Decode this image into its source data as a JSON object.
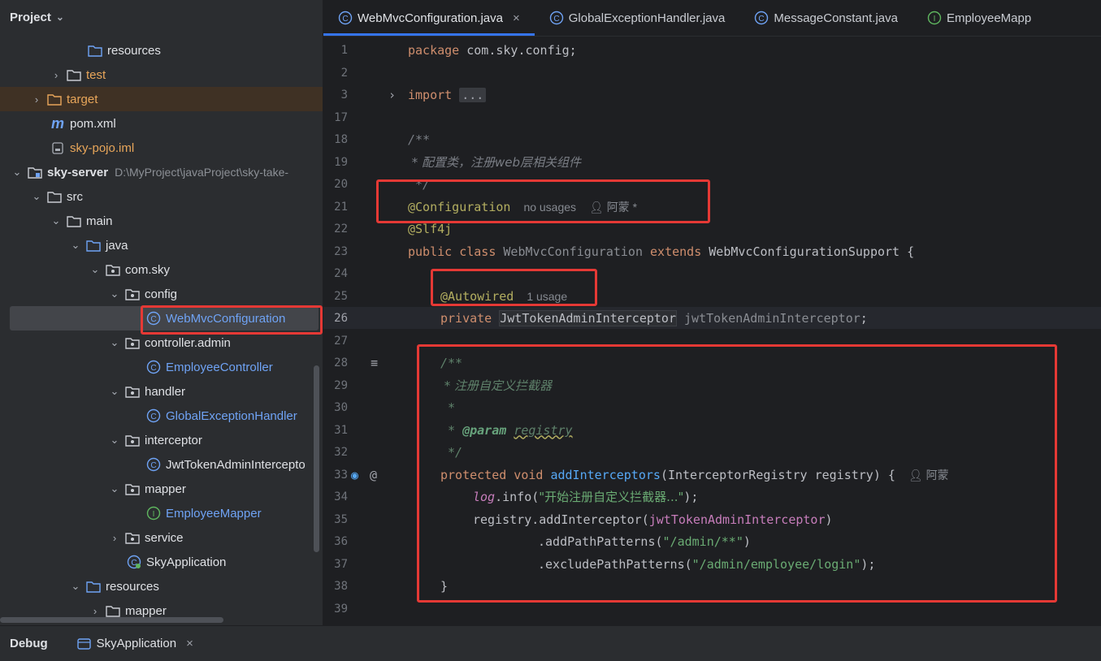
{
  "project_panel": {
    "title": "Project",
    "tree": [
      {
        "label": "resources",
        "icon": "folder-icon",
        "style": "normal"
      },
      {
        "label": "test",
        "icon": "folder-icon",
        "style": "orange",
        "expanded": false
      },
      {
        "label": "target",
        "icon": "folder-orange-icon",
        "style": "orange",
        "expanded": false
      },
      {
        "label": "pom.xml",
        "icon": "maven-icon",
        "style": "normal"
      },
      {
        "label": "sky-pojo.iml",
        "icon": "iml-file-icon",
        "style": "orange"
      },
      {
        "label": "sky-server",
        "path": "D:\\MyProject\\javaProject\\sky-take-",
        "icon": "module-folder-icon",
        "style": "bold",
        "expanded": true
      },
      {
        "label": "src",
        "icon": "folder-icon",
        "style": "normal",
        "expanded": true
      },
      {
        "label": "main",
        "icon": "folder-icon",
        "style": "normal",
        "expanded": true
      },
      {
        "label": "java",
        "icon": "source-folder-icon",
        "style": "normal",
        "expanded": true
      },
      {
        "label": "com.sky",
        "icon": "package-icon",
        "style": "normal",
        "expanded": true
      },
      {
        "label": "config",
        "icon": "package-icon",
        "style": "normal",
        "expanded": true
      },
      {
        "label": "WebMvcConfiguration",
        "icon": "class-icon",
        "style": "blue",
        "selected": true
      },
      {
        "label": "controller.admin",
        "icon": "package-icon",
        "style": "normal",
        "expanded": true
      },
      {
        "label": "EmployeeController",
        "icon": "class-icon",
        "style": "blue"
      },
      {
        "label": "handler",
        "icon": "package-icon",
        "style": "normal",
        "expanded": true
      },
      {
        "label": "GlobalExceptionHandler",
        "icon": "class-icon",
        "style": "blue"
      },
      {
        "label": "interceptor",
        "icon": "package-icon",
        "style": "normal",
        "expanded": true
      },
      {
        "label": "JwtTokenAdminIntercepto",
        "icon": "class-icon",
        "style": "normal"
      },
      {
        "label": "mapper",
        "icon": "package-icon",
        "style": "normal",
        "expanded": true
      },
      {
        "label": "EmployeeMapper",
        "icon": "interface-icon",
        "style": "blue"
      },
      {
        "label": "service",
        "icon": "package-icon",
        "style": "normal",
        "expanded": false
      },
      {
        "label": "SkyApplication",
        "icon": "spring-boot-class-icon",
        "style": "normal"
      },
      {
        "label": "resources",
        "icon": "resources-folder-icon",
        "style": "normal",
        "expanded": true
      },
      {
        "label": "mapper",
        "icon": "folder-icon",
        "style": "normal",
        "expanded": false
      }
    ]
  },
  "tabs": [
    {
      "label": "WebMvcConfiguration.java",
      "icon": "class-icon",
      "active": true,
      "close": "×"
    },
    {
      "label": "GlobalExceptionHandler.java",
      "icon": "class-icon",
      "active": false
    },
    {
      "label": "MessageConstant.java",
      "icon": "class-icon",
      "active": false
    },
    {
      "label": "EmployeeMapp",
      "icon": "interface-icon",
      "active": false
    }
  ],
  "editor": {
    "current_line": 26,
    "lines": [
      {
        "n": "1",
        "text": "package com.sky.config;"
      },
      {
        "n": "2",
        "text": ""
      },
      {
        "n": "3",
        "text": "import ..."
      },
      {
        "n": "17",
        "text": ""
      },
      {
        "n": "18",
        "text": "/**"
      },
      {
        "n": "19",
        "text": " * 配置类，注册web层相关组件"
      },
      {
        "n": "20",
        "text": " */"
      },
      {
        "n": "21",
        "text": "@Configuration",
        "hint_usages": "no usages",
        "hint_author": "阿蒙 *"
      },
      {
        "n": "22",
        "text": "@Slf4j"
      },
      {
        "n": "23",
        "text": "public class WebMvcConfiguration extends WebMvcConfigurationSupport {"
      },
      {
        "n": "24",
        "text": ""
      },
      {
        "n": "25",
        "text": "@Autowired",
        "hint_usages": "1 usage"
      },
      {
        "n": "26",
        "text": "private JwtTokenAdminInterceptor jwtTokenAdminInterceptor;"
      },
      {
        "n": "27",
        "text": ""
      },
      {
        "n": "28",
        "text": "/**"
      },
      {
        "n": "29",
        "text": " * 注册自定义拦截器"
      },
      {
        "n": "30",
        "text": " *"
      },
      {
        "n": "31",
        "text": " * @param registry"
      },
      {
        "n": "32",
        "text": " */"
      },
      {
        "n": "33",
        "text": "protected void addInterceptors(InterceptorRegistry registry) {",
        "hint_author": "阿蒙"
      },
      {
        "n": "34",
        "text": "log.info(\"开始注册自定义拦截器...\");"
      },
      {
        "n": "35",
        "text": "registry.addInterceptor(jwtTokenAdminInterceptor)"
      },
      {
        "n": "36",
        "text": ".addPathPatterns(\"/admin/**\")"
      },
      {
        "n": "37",
        "text": ".excludePathPatterns(\"/admin/employee/login\");"
      },
      {
        "n": "38",
        "text": "}"
      },
      {
        "n": "39",
        "text": ""
      }
    ]
  },
  "bottom_bar": {
    "title": "Debug",
    "run_tab": "SkyApplication",
    "run_tab_close": "×"
  },
  "colors": {
    "accent": "#3574f0",
    "highlight_box": "#e53935",
    "keyword": "#cf8e6d",
    "annotation": "#b3ae60",
    "string": "#6aab73",
    "method": "#56a8f5",
    "field": "#c77dbb"
  }
}
